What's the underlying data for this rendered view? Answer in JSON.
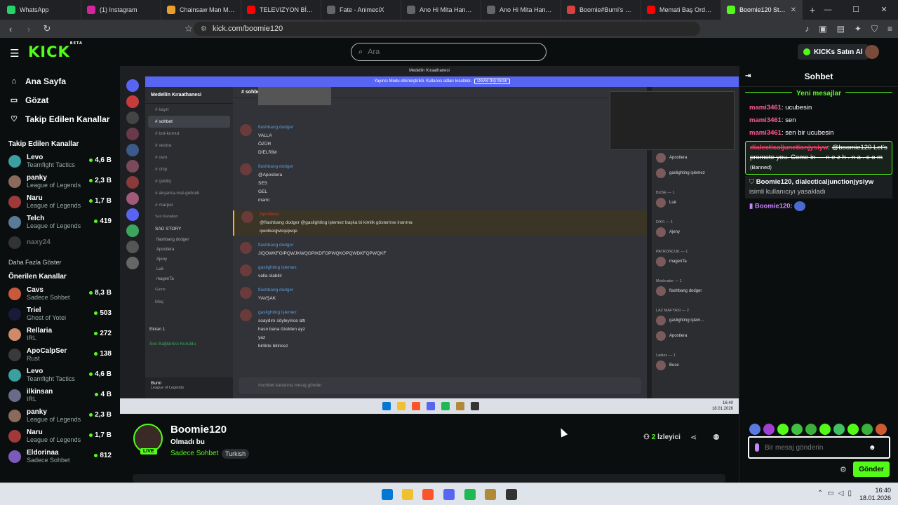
{
  "browser": {
    "tabs": [
      {
        "title": "WhatsApp",
        "color": "#25d366"
      },
      {
        "title": "(1) Instagram",
        "color": "#d6249f"
      },
      {
        "title": "Chainsaw Man Movie:",
        "color": "#e8a02a"
      },
      {
        "title": "TELEVIZYON BİZİ KAN",
        "color": "#ff0000"
      },
      {
        "title": "Fate - AnimeciX",
        "color": "#666666"
      },
      {
        "title": "Ano Hi Mita Hana no N",
        "color": "#666666"
      },
      {
        "title": "Ano Hi Mita Hana no N",
        "color": "#666666"
      },
      {
        "title": "Boomie#Bumi's Comp",
        "color": "#d94040"
      },
      {
        "title": "Memati Baş Orda Oldu",
        "color": "#ff0000"
      },
      {
        "title": "Boomie120 Stream",
        "color": "#53fc18"
      }
    ],
    "url": "kick.com/boomie120"
  },
  "header": {
    "logo": "KICK",
    "logo_badge": "BETA",
    "search_placeholder": "Ara",
    "kicks_label": "KICKs Satın Al"
  },
  "sidebar": {
    "nav": [
      {
        "label": "Ana Sayfa",
        "icon": "home-icon",
        "glyph": "⌂"
      },
      {
        "label": "Gözat",
        "icon": "browse-icon",
        "glyph": "▭"
      },
      {
        "label": "Takip Edilen Kanallar",
        "icon": "heart-icon",
        "glyph": "♡"
      }
    ],
    "followed_title": "Takip Edilen Kanallar",
    "followed": [
      {
        "name": "Levo",
        "category": "Teamfight Tactics",
        "viewers": "4,6 B",
        "color": "#3aa0a0"
      },
      {
        "name": "panky",
        "category": "League of Legends",
        "viewers": "2,3 B",
        "color": "#8a6a5a"
      },
      {
        "name": "Naru",
        "category": "League of Legends",
        "viewers": "1,7 B",
        "color": "#a03a3a"
      },
      {
        "name": "Telch",
        "category": "League of Legends",
        "viewers": "419",
        "color": "#5a7a9a"
      },
      {
        "name": "naxy24",
        "category": "",
        "viewers": "",
        "color": "#333333"
      }
    ],
    "more_label": "Daha Fazla Göster",
    "recommended_title": "Önerilen Kanallar",
    "recommended": [
      {
        "name": "Cavs",
        "category": "Sadece Sohbet",
        "viewers": "8,3 B",
        "color": "#c85a3a"
      },
      {
        "name": "Triel",
        "category": "Ghost of Yotei",
        "viewers": "503",
        "color": "#1a1a3a"
      },
      {
        "name": "Rellaria",
        "category": "IRL",
        "viewers": "272",
        "color": "#d08a6a"
      },
      {
        "name": "ApoCalpSer",
        "category": "Rust",
        "viewers": "138",
        "color": "#3a3a3a"
      },
      {
        "name": "Levo",
        "category": "Teamfight Tactics",
        "viewers": "4,6 B",
        "color": "#3aa0a0"
      },
      {
        "name": "ilkinsan",
        "category": "IRL",
        "viewers": "4 B",
        "color": "#6a6a8a"
      },
      {
        "name": "panky",
        "category": "League of Legends",
        "viewers": "2,3 B",
        "color": "#8a6a5a"
      },
      {
        "name": "Naru",
        "category": "League of Legends",
        "viewers": "1,7 B",
        "color": "#a03a3a"
      },
      {
        "name": "Eldorinaa",
        "category": "Sadece Sohbet",
        "viewers": "812",
        "color": "#7a5aba"
      }
    ]
  },
  "stream_content": {
    "window_title": "Medellin Kıraathanesi",
    "banner_text": "Yayıncı Modu etkinleştirildi. Kullanıcı adları kısaltıldı.",
    "banner_button": "Devre dışı bırak",
    "server_name": "Medellin Kıraathanesi",
    "channels": [
      "kayıt",
      "sohbet",
      "bot-komut",
      "vestra",
      "owo",
      "chip",
      "çekiliş",
      "akşama-mal-gelicek",
      "marpel"
    ],
    "voice_header": "Ses Kanalları",
    "voice_channel": "SAD STORY",
    "voice_members": [
      "flashbang dodger",
      "Apostiera",
      "Ajeny",
      "Luè",
      "magenTa"
    ],
    "game_header": "Game",
    "game_channel": "Maç",
    "screen_label": "Ekran 1",
    "connection": "Ses Bağlantısı Kuruldu",
    "user": "Bumi",
    "user_status": "League of Legends",
    "channel_header": "sohbet",
    "messages": [
      {
        "user": "flashbang dodger",
        "lines": [
          "VALLA",
          "ÖZÜR",
          "DİELRİM"
        ]
      },
      {
        "user": "flashbang dodger",
        "lines": [
          "@Apostiera",
          "SES",
          "GEL",
          "mami"
        ]
      },
      {
        "user": "Apostiera",
        "lines": [
          "@flashbang dodger @gaslighting işlemez başka bi kimlik gösterirse inanma",
          "qwolkeqjwkqejwqe"
        ]
      },
      {
        "user": "flashbang dodger",
        "lines": [
          "JIQOWKFOIPQWJKWQOPIKDFOPWQKOPQWDKFQPWQKF"
        ]
      },
      {
        "user": "gaslighting işlemez",
        "lines": [
          "valla olabilir"
        ]
      },
      {
        "user": "flashbang dodger",
        "lines": [
          "YAVŞAK"
        ]
      },
      {
        "user": "gaslighting işlemez",
        "lines": [
          "soaydını söyleyince attı",
          "hasn bana özelden ayz",
          "yaz",
          "birlikte bitiricez"
        ]
      }
    ],
    "input_placeholder": "#sohbet kanalına mesaj gönder",
    "members": [
      {
        "group": "",
        "name": "Apostiera"
      },
      {
        "group": "",
        "name": "gaslighting işlemez"
      },
      {
        "group": "BUSE — 1",
        "name": "Luè"
      },
      {
        "group": "DAYI — 1",
        "name": "Ajeny"
      },
      {
        "group": "PATRONCUK — 1",
        "name": "magenTa"
      },
      {
        "group": "Moderator — 1",
        "name": "flashbang dodger"
      },
      {
        "group": "LAZ MAFYASI — 2",
        "name": "gaslighting işlem..."
      },
      {
        "group": "",
        "name": "Apostiera"
      },
      {
        "group": "Ladies — 1",
        "name": "Buse"
      }
    ],
    "mini_clock": "16:40",
    "mini_date": "18.01.2026"
  },
  "stream_info": {
    "streamer": "Boomie120",
    "live_label": "LIVE",
    "title": "Olmadı bu",
    "category": "Sadece Sohbet",
    "tag": "Turkish",
    "viewers_count": "2",
    "viewers_label": "İzleyici"
  },
  "chat": {
    "title": "Sohbet",
    "new_messages": "Yeni mesajlar",
    "messages": [
      {
        "user": "mami3461",
        "text": "ucubesin"
      },
      {
        "user": "mami3461",
        "text": "sen"
      },
      {
        "user": "mami3461",
        "text": "sen bir ucubesin"
      }
    ],
    "banned": {
      "user": "dialecticaljunctionjysiyw",
      "text": "@boomie120 Let's promote you. Come in — n e z h . n a . c o m",
      "tag": "(Banned)"
    },
    "system": {
      "prefix": "Boomie120, dialecticaljunctionjysiyw",
      "text": "isimli kullanıcıyı yasakladı"
    },
    "own_message_user": "Boomie120:",
    "input_placeholder": "Bir mesaj gönderin",
    "send_label": "Gönder"
  },
  "taskbar": {
    "clock": "16:40",
    "date": "18.01.2026"
  }
}
